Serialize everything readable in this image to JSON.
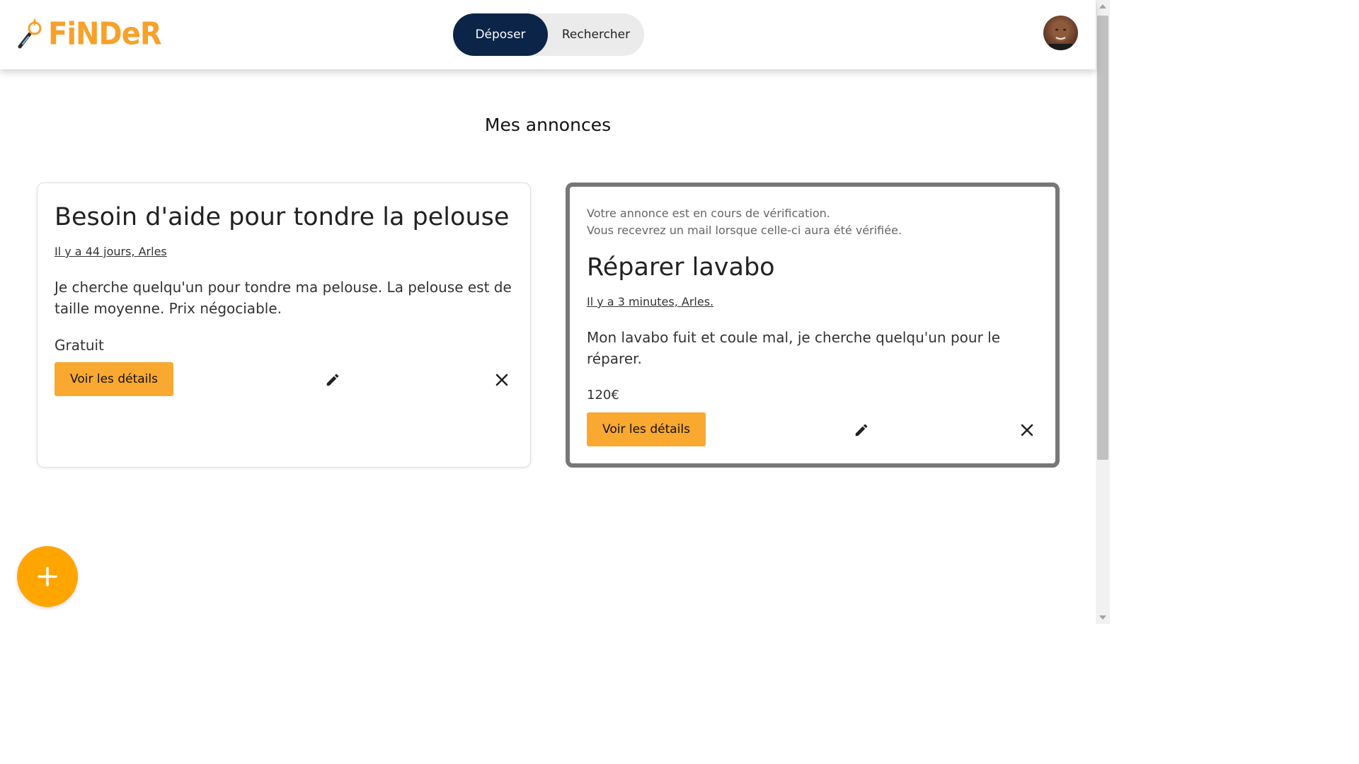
{
  "header": {
    "logo_text": "FiNDeR",
    "toggle": {
      "active_label": "Déposer",
      "inactive_label": "Rechercher"
    }
  },
  "main": {
    "title": "Mes annonces",
    "cards": [
      {
        "title": "Besoin d'aide pour tondre la pelouse",
        "meta": "Il y a 44 jours, Arles",
        "description": "Je cherche quelqu'un pour tondre ma pelouse. La pelouse est de taille moyenne. Prix négociable.",
        "price": "Gratuit",
        "details_label": "Voir les détails"
      },
      {
        "notice_line1": "Votre annonce est en cours de vérification.",
        "notice_line2": "Vous recevrez un mail lorsque celle-ci aura été vérifiée.",
        "title": "Réparer lavabo",
        "meta": "Il y a 3 minutes, Arles.",
        "description": "Mon lavabo fuit et coule mal, je cherche quelqu'un pour le réparer.",
        "price": "120€",
        "details_label": "Voir les détails"
      }
    ]
  },
  "colors": {
    "brand_orange": "#F7A12A",
    "toggle_active": "#0b2447",
    "button": "#F9A830",
    "fab": "#FFA500",
    "pending_border": "#777777"
  },
  "icons": [
    "magnifier-logo-icon",
    "avatar",
    "edit-pencil-icon",
    "close-icon",
    "plus-icon"
  ]
}
